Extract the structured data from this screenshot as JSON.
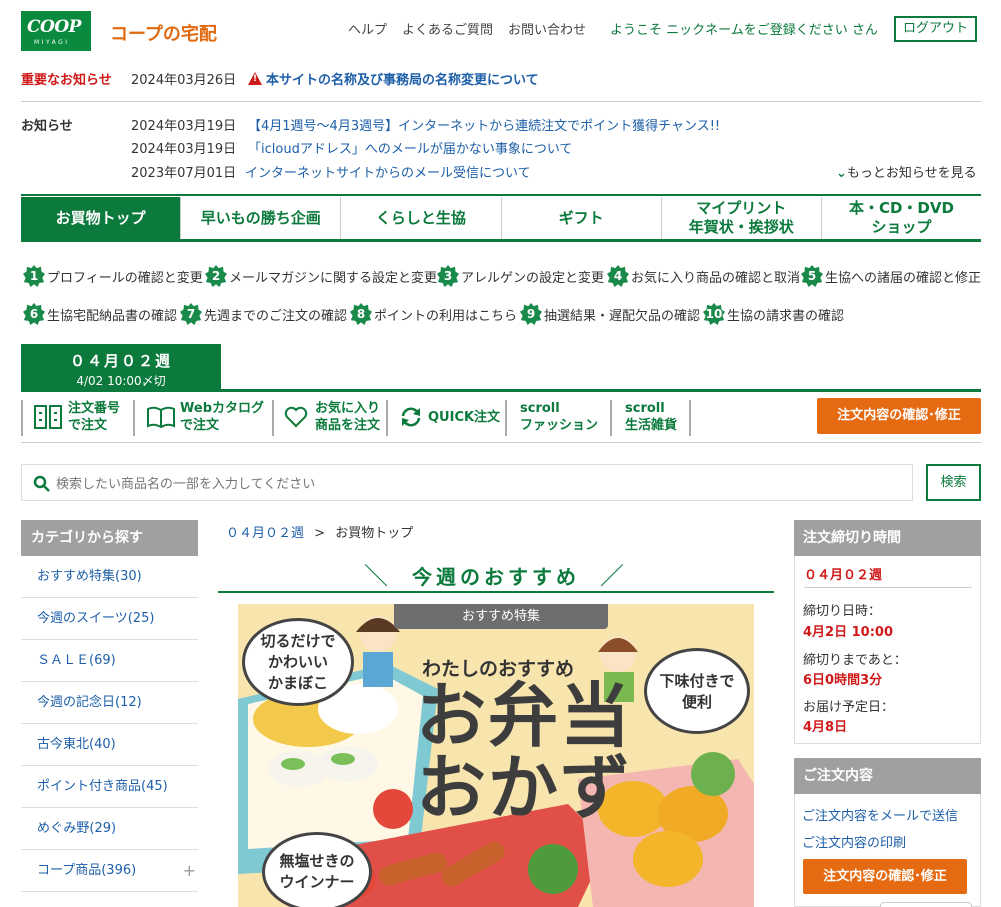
{
  "header": {
    "logo_main": "COOP",
    "logo_sub": "MIYAGI",
    "site_title": "コープの宅配",
    "nav": [
      "ヘルプ",
      "よくあるご質問",
      "お問い合わせ"
    ],
    "welcome": "ようこそ ニックネームをご登録ください さん",
    "logout": "ログアウト"
  },
  "important_notice": {
    "label": "重要なお知らせ",
    "date": "2024年03月26日",
    "text": "本サイトの名称及び事務局の名称変更について"
  },
  "news": {
    "label": "お知らせ",
    "items": [
      {
        "date": "2024年03月19日",
        "text": "【4月1週号～4月3週号】インターネットから連続注文でポイント獲得チャンス!!"
      },
      {
        "date": "2024年03月19日",
        "text": "「icloudアドレス」へのメールが届かない事象について"
      },
      {
        "date": "2023年07月01日",
        "text": "インターネットサイトからのメール受信について"
      }
    ],
    "more": "もっとお知らせを見る"
  },
  "main_tabs": [
    {
      "label": "お買物トップ"
    },
    {
      "label": "早いもの勝ち企画"
    },
    {
      "label": "くらしと生協"
    },
    {
      "label": "ギフト"
    },
    {
      "label": "マイプリント\n年賀状・挨拶状"
    },
    {
      "label": "本・CD・DVD\nショップ"
    }
  ],
  "numbered_links": [
    {
      "num": "1",
      "text": "プロフィールの確認と変更"
    },
    {
      "num": "2",
      "text": "メールマガジンに関する設定と変更"
    },
    {
      "num": "3",
      "text": "アレルゲンの設定と変更"
    },
    {
      "num": "4",
      "text": "お気に入り商品の確認と取消"
    },
    {
      "num": "5",
      "text": "生協への諸届の確認と修正"
    },
    {
      "num": "6",
      "text": "生協宅配納品書の確認"
    },
    {
      "num": "7",
      "text": "先週までのご注文の確認"
    },
    {
      "num": "8",
      "text": "ポイントの利用はこちら"
    },
    {
      "num": "9",
      "text": "抽選結果・遅配欠品の確認"
    },
    {
      "num": "10",
      "text": "生協の請求書の確認"
    }
  ],
  "week": {
    "title": "０４月０２週",
    "deadline": "4/02 10:00〆切"
  },
  "subnav": {
    "items": [
      {
        "l1": "注文番号",
        "l2": "で注文"
      },
      {
        "l1": "Webカタログ",
        "l2": "で注文"
      },
      {
        "l1": "お気に入り",
        "l2": "商品を注文"
      },
      {
        "l1": "QUICK注文",
        "l2": ""
      },
      {
        "l1": "scroll",
        "l2": "ファッション"
      },
      {
        "l1": "scroll",
        "l2": "生活雑貨"
      }
    ],
    "order_confirm": "注文内容の確認･修正"
  },
  "search": {
    "placeholder": "検索したい商品名の一部を入力してください",
    "button": "検索"
  },
  "categories": {
    "title": "カテゴリから探す",
    "items": [
      "おすすめ特集(30)",
      "今週のスイーツ(25)",
      "ＳＡＬＥ(69)",
      "今週の記念日(12)",
      "古今東北(40)",
      "ポイント付き商品(45)",
      "めぐみ野(29)",
      "コープ商品(396)"
    ]
  },
  "breadcrumb": {
    "week": "０４月０２週",
    "sep": ">",
    "current": "お買物トップ"
  },
  "recommend": {
    "title": "今週のおすすめ",
    "banner": {
      "tag": "おすすめ特集",
      "headline_small": "わたしのおすすめ",
      "headline_1": "お弁当",
      "headline_2": "おかず",
      "bubble_1": "切るだけで\nかわいい\nかまぼこ",
      "bubble_2": "下味付きで\n便利",
      "bubble_3": "無塩せきの\nウインナー"
    }
  },
  "deadline_box": {
    "title": "注文締切り時間",
    "week": "０４月０２週",
    "close_label": "締切り日時：",
    "close_value": "4月2日 10:00",
    "remain_label": "締切りまであと：",
    "remain_value": "6日0時間3分",
    "delivery_label": "お届け予定日：",
    "delivery_value": "4月8日"
  },
  "order_box": {
    "title": "ご注文内容",
    "send_mail": "ご注文内容をメールで送信",
    "print": "ご注文内容の印刷",
    "confirm": "注文内容の確認･修正"
  }
}
